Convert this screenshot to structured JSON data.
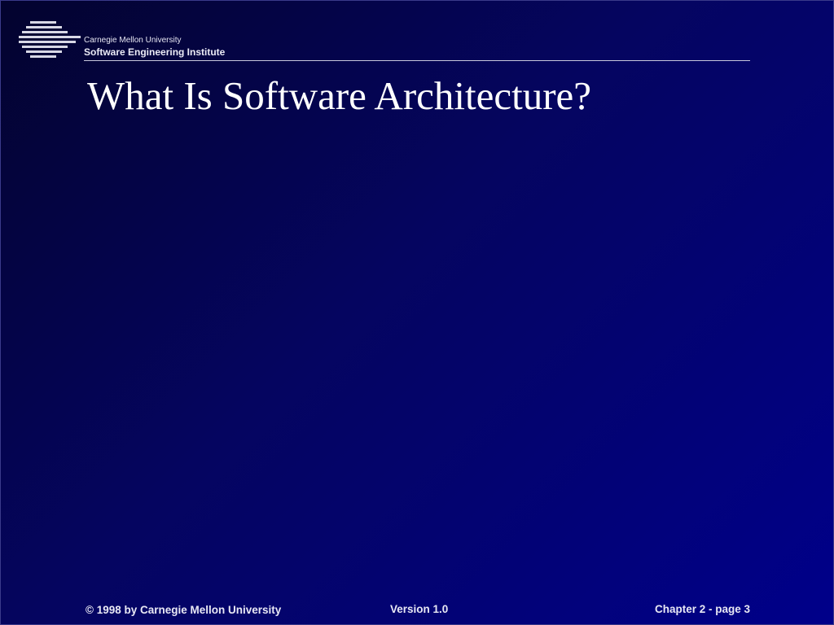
{
  "header": {
    "logo_icon": "sei-striped-logo-icon",
    "org_name": "Carnegie Mellon University",
    "institute_name": "Software Engineering Institute"
  },
  "slide": {
    "title": "What Is Software Architecture?"
  },
  "footer": {
    "copyright": "© 1998 by Carnegie Mellon University",
    "version": "Version 1.0",
    "page": "Chapter 2  - page 3"
  },
  "colors": {
    "background_dark": "#03032e",
    "background_mid": "#050560",
    "background_light": "#00008a",
    "text": "#ffffff"
  }
}
